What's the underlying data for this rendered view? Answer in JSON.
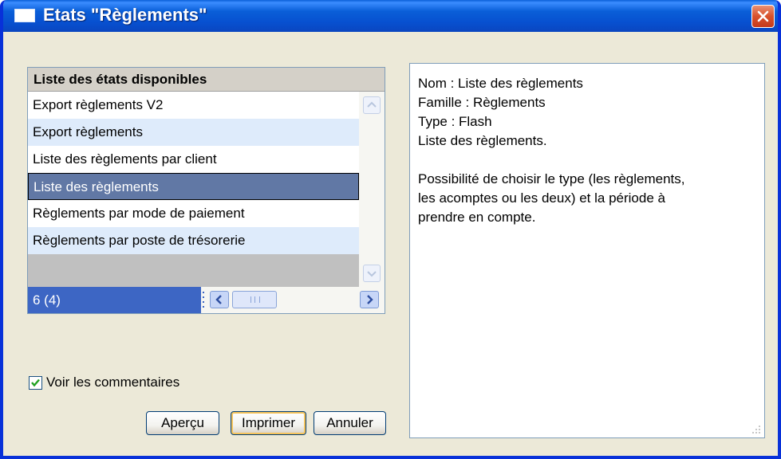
{
  "window": {
    "title": "Etats \"Règlements\""
  },
  "list": {
    "header": "Liste des états disponibles",
    "items": [
      {
        "label": "Export règlements V2"
      },
      {
        "label": "Export règlements"
      },
      {
        "label": "Liste des règlements par client"
      },
      {
        "label": "Liste des règlements",
        "selected": true
      },
      {
        "label": "Règlements par mode de paiement"
      },
      {
        "label": "Règlements par poste de trésorerie"
      }
    ],
    "count": "6 (4)"
  },
  "description": {
    "line1": "Nom : Liste des règlements",
    "line2": "Famille : Règlements",
    "line3": "Type : Flash",
    "line4": "Liste des règlements.",
    "para1": "Possibilité de choisir le type (les règlements,",
    "para2": "les acomptes ou les deux) et la période à",
    "para3": "prendre en compte."
  },
  "options": {
    "show_comments_label": "Voir les commentaires",
    "show_comments_checked": true
  },
  "buttons": {
    "preview": "Aperçu",
    "print": "Imprimer",
    "cancel": "Annuler"
  },
  "colors": {
    "titlebar": "#0a5fd8",
    "selection": "#6178a5",
    "row_alt": "#deebfb",
    "count_bg": "#3d66c4",
    "close": "#d8512c"
  }
}
